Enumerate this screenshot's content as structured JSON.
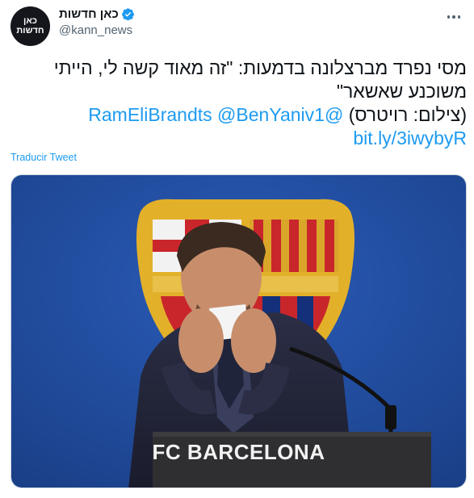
{
  "tweet": {
    "avatar": {
      "line1": "כאן",
      "line2": "חדשות"
    },
    "display_name": "כאן חדשות",
    "handle": "@kann_news",
    "text_line1": "מסי נפרד מברצלונה בדמעות: \"זה מאוד קשה לי, הייתי",
    "text_line2": "משוכנע שאשאר\"",
    "credit": "(צילום: רויטרס)",
    "mention1": "@BenYaniv1",
    "mention2": "@RamEliBrandts",
    "short_link": "bit.ly/3iwybyR",
    "translate_label": "Traducir Tweet",
    "podium_text": "FC BARCELONA"
  },
  "colors": {
    "link": "#1d9bf0",
    "verified": "#1d9bf0",
    "photo_background": "#1f4a99"
  },
  "icons": [
    "verified-badge-icon",
    "more-options-icon"
  ]
}
